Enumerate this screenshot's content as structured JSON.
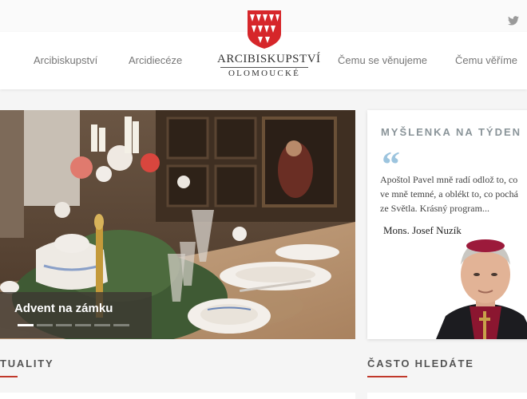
{
  "colors": {
    "accent": "#c0392b",
    "quote_icon": "#9cc4de",
    "title_gray": "#8a9499"
  },
  "social": {
    "icon": "twitter-icon"
  },
  "nav": {
    "left": [
      "Arcibiskupství",
      "Arcidiecéze"
    ],
    "right": [
      "Čemu se věnujeme",
      "Čemu věříme"
    ]
  },
  "logo": {
    "title": "ARCIBISKUPSTVÍ",
    "subtitle": "OLOMOUCKÉ"
  },
  "hero": {
    "caption": "Advent na zámku",
    "slides": 6,
    "active_slide": 0
  },
  "thought": {
    "title": "MYŠLENKA NA TÝDEN",
    "quote_lines": [
      "Apoštol Pavel mně radí odlož to, co",
      "ve mně temné, a oblékt to, co pochá",
      "ze Světla. Krásný program..."
    ],
    "author": "Mons. Josef Nuzík"
  },
  "sections": {
    "news": "TUALITY",
    "frequent": "ČASTO HLEDÁTE"
  }
}
